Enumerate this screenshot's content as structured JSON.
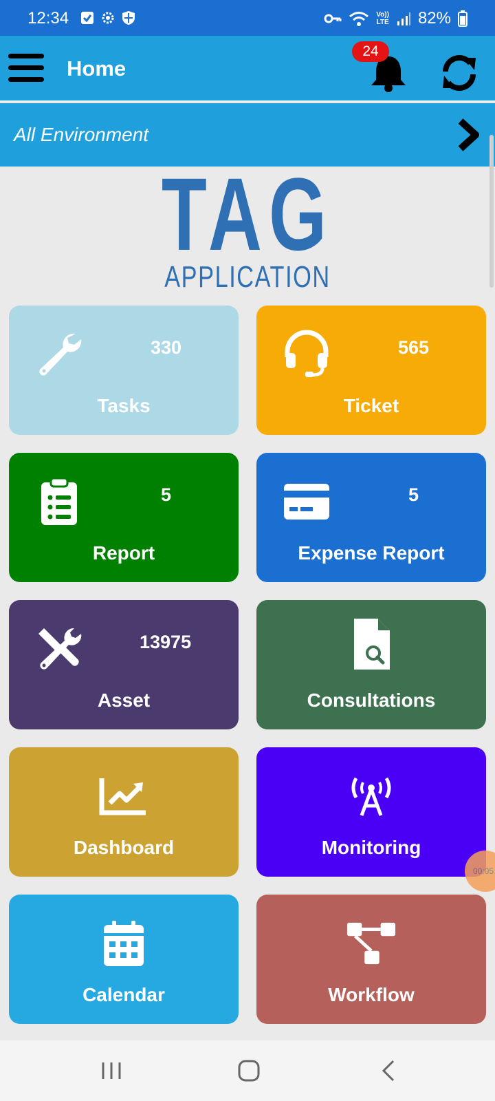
{
  "status_bar": {
    "time": "12:34",
    "battery": "82%",
    "lte_top": "Vo))",
    "lte_bottom": "LTE"
  },
  "header": {
    "title": "Home",
    "notification_count": "24"
  },
  "environment": {
    "label": "All Environment"
  },
  "logo": {
    "main": "TAG",
    "sub": "APPLICATION"
  },
  "tiles": [
    {
      "label": "Tasks",
      "count": "330",
      "color": "#add8e6",
      "icon": "wrench-icon"
    },
    {
      "label": "Ticket",
      "count": "565",
      "color": "#f6ab06",
      "icon": "headset-icon"
    },
    {
      "label": "Report",
      "count": "5",
      "color": "#008000",
      "icon": "clipboard-list-icon"
    },
    {
      "label": "Expense Report",
      "count": "5",
      "color": "#1a6fd0",
      "icon": "credit-card-icon"
    },
    {
      "label": "Asset",
      "count": "13975",
      "color": "#4b3a6e",
      "icon": "tools-icon"
    },
    {
      "label": "Consultations",
      "count": "",
      "color": "#3d7150",
      "icon": "file-search-icon"
    },
    {
      "label": "Dashboard",
      "count": "",
      "color": "#cca333",
      "icon": "chart-line-icon"
    },
    {
      "label": "Monitoring",
      "count": "",
      "color": "#4a00f5",
      "icon": "broadcast-tower-icon"
    },
    {
      "label": "Calendar",
      "count": "",
      "color": "#26a8e0",
      "icon": "calendar-icon"
    },
    {
      "label": "Workflow",
      "count": "",
      "color": "#b5605a",
      "icon": "sitemap-icon"
    }
  ],
  "floating": {
    "label": "00:05"
  }
}
